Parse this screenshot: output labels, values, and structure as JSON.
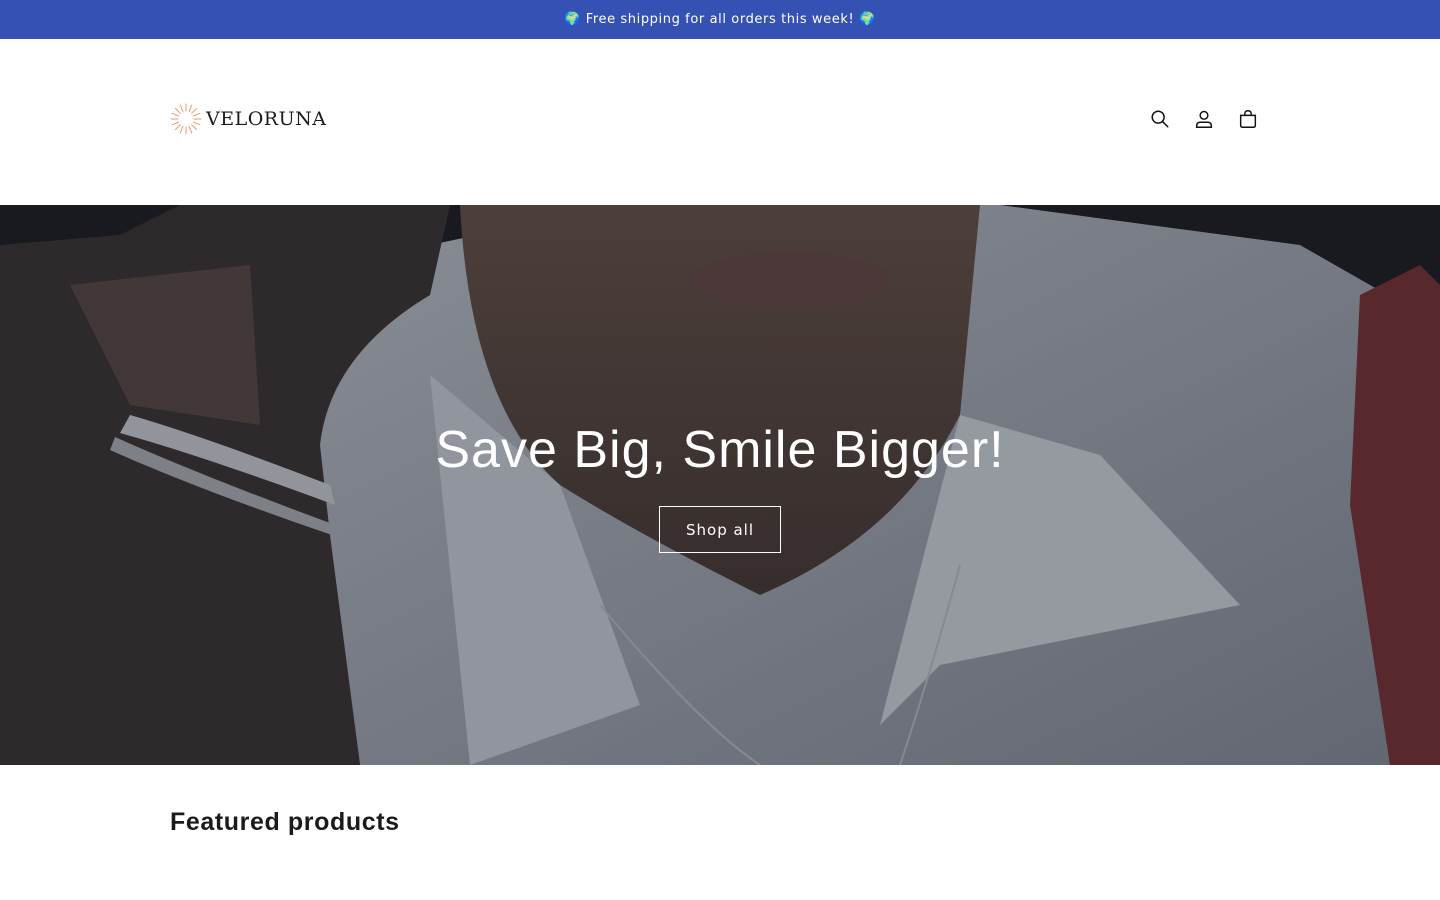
{
  "announcement": {
    "text": "🌍 Free shipping for all orders this week! 🌍"
  },
  "header": {
    "logo_text": "VELORUNA",
    "icons": [
      "search-icon",
      "account-icon",
      "cart-icon"
    ]
  },
  "hero": {
    "title": "Save Big, Smile Bigger!",
    "button_label": "Shop all"
  },
  "featured": {
    "title": "Featured products"
  },
  "colors": {
    "announcement_bg": "#3651b4",
    "logo_accent": "#e79a74",
    "text": "#121212"
  }
}
